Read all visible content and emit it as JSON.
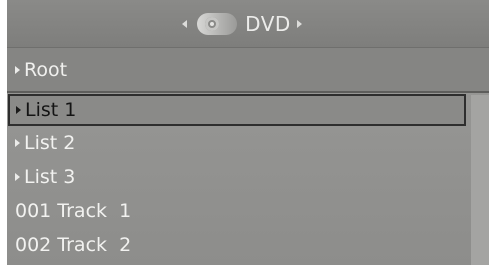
{
  "header": {
    "title": "DVD",
    "left_icon": "chevron-left-icon",
    "right_icon": "chevron-right-icon",
    "source_icon": "disc-icon"
  },
  "breadcrumb": {
    "label": "Root"
  },
  "items": [
    {
      "label": "List 1",
      "type": "folder",
      "selected": true
    },
    {
      "label": "List 2",
      "type": "folder",
      "selected": false
    },
    {
      "label": "List 3",
      "type": "folder",
      "selected": false
    },
    {
      "label": "001 Track  1",
      "type": "track",
      "selected": false
    },
    {
      "label": "002 Track  2",
      "type": "track",
      "selected": false
    }
  ],
  "colors": {
    "background": "#8d8d8b",
    "text": "#f2f2f0",
    "selected_border": "#2e2e2e"
  }
}
